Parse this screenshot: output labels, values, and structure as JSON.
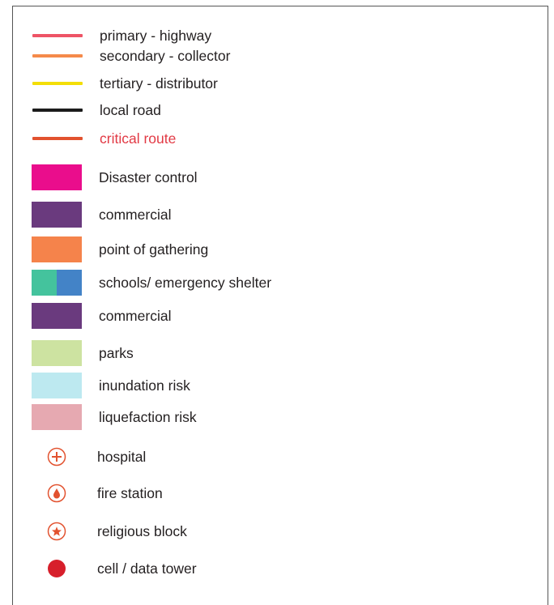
{
  "roads": [
    {
      "label": "primary - highway",
      "color": "#ee5466"
    },
    {
      "label": "secondary - collector",
      "color": "#f58a4a"
    },
    {
      "label": "tertiary - distributor",
      "color": "#f3de06"
    },
    {
      "label": "local road",
      "color": "#1b1b1b"
    },
    {
      "label": "critical route",
      "color": "#e2522f",
      "text_color": "#e23a45"
    }
  ],
  "areas": [
    {
      "label": "Disaster control",
      "colors": [
        "#ea0d8c"
      ]
    },
    {
      "label": "commercial",
      "colors": [
        "#6a3a7e"
      ]
    },
    {
      "label": "point of gathering",
      "colors": [
        "#f5834b"
      ]
    },
    {
      "label": "schools/ emergency shelter",
      "colors": [
        "#44c39d",
        "#4383c7"
      ]
    },
    {
      "label": "commercial",
      "colors": [
        "#6a3a7e"
      ]
    },
    {
      "label": "parks",
      "colors": [
        "#cde3a1"
      ]
    },
    {
      "label": "inundation risk",
      "colors": [
        "#bde9f0"
      ]
    },
    {
      "label": "liquefaction risk",
      "colors": [
        "#e6a9b1"
      ]
    }
  ],
  "facilities": [
    {
      "label": "hospital",
      "icon": "hospital-icon",
      "color": "#e2522f"
    },
    {
      "label": "fire station",
      "icon": "fire-station-icon",
      "color": "#e2522f"
    },
    {
      "label": "religious block",
      "icon": "religious-block-icon",
      "color": "#e2522f"
    },
    {
      "label": "cell / data tower",
      "icon": "cell-tower-icon",
      "color": "#d71f2b"
    }
  ]
}
